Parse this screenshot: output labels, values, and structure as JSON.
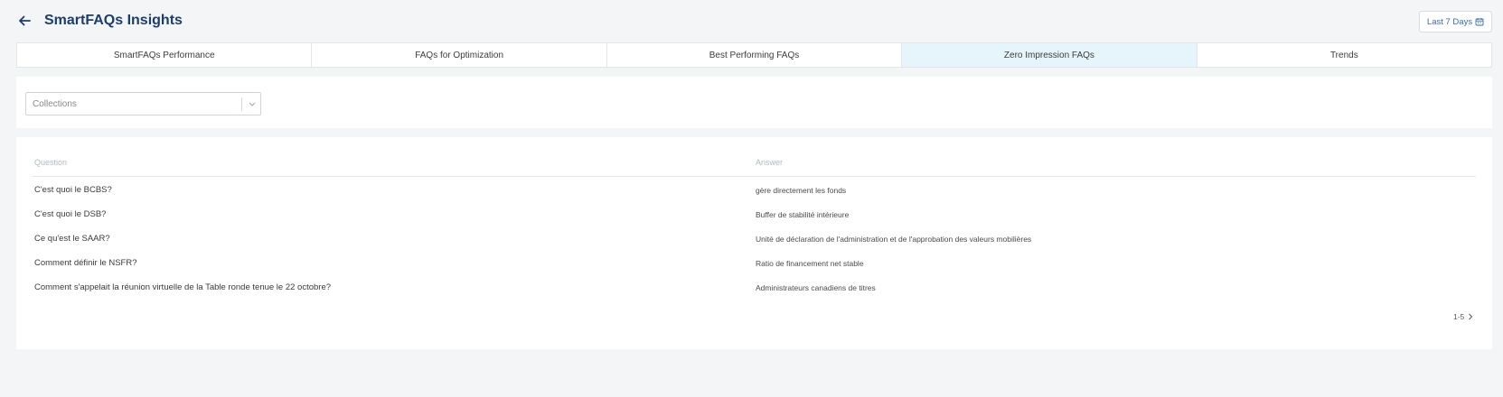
{
  "header": {
    "title": "SmartFAQs Insights",
    "back_icon": "arrow-left-icon",
    "date_range_label": "Last 7 Days",
    "date_icon": "calendar-icon"
  },
  "tabs": [
    {
      "label": "SmartFAQs Performance",
      "active": false
    },
    {
      "label": "FAQs for Optimization",
      "active": false
    },
    {
      "label": "Best Performing FAQs",
      "active": false
    },
    {
      "label": "Zero Impression FAQs",
      "active": true
    },
    {
      "label": "Trends",
      "active": false
    }
  ],
  "filters": {
    "collections_placeholder": "Collections"
  },
  "table": {
    "columns": {
      "question": "Question",
      "answer": "Answer"
    },
    "rows": [
      {
        "question": "C'est quoi le BCBS?",
        "answer": "gère directement les fonds"
      },
      {
        "question": "C'est quoi le DSB?",
        "answer": "Buffer de stabilité intérieure"
      },
      {
        "question": "Ce qu'est le SAAR?",
        "answer": "Unité de déclaration de l'administration et de l'approbation des valeurs mobilières"
      },
      {
        "question": "Comment définir le NSFR?",
        "answer": "Ratio de financement net stable"
      },
      {
        "question": "Comment s'appelait la réunion virtuelle de la Table ronde tenue le 22 octobre?",
        "answer": "Administrateurs canadiens de titres"
      }
    ]
  },
  "pagination": {
    "range": "1-5"
  },
  "colors": {
    "accent": "#1d3d6b",
    "active_tab": "#e6f4fc",
    "link": "#3a6aa8"
  }
}
